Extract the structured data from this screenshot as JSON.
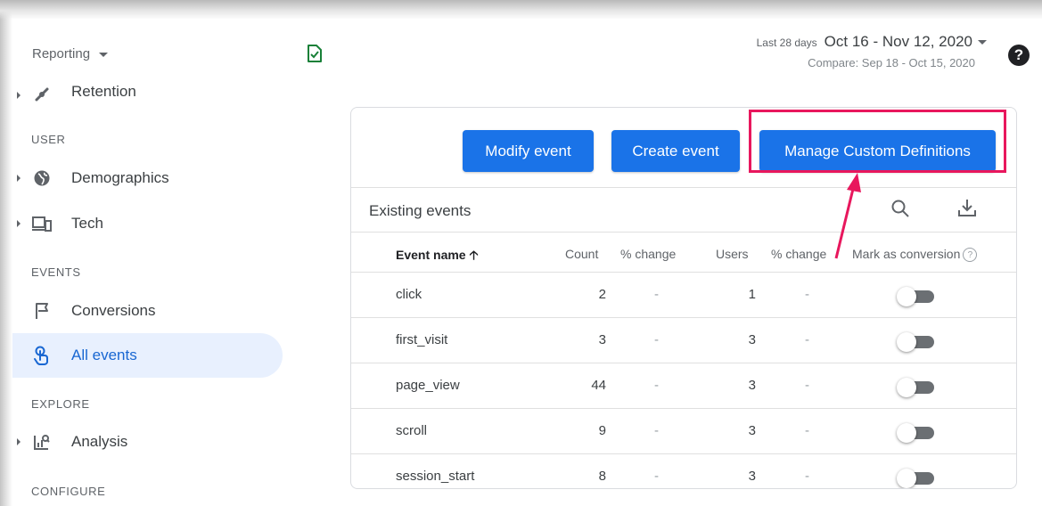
{
  "sidebar": {
    "reporting_label": "Reporting",
    "retention_label": "Retention",
    "sections": {
      "user": "USER",
      "events": "EVENTS",
      "explore": "EXPLORE",
      "configure": "CONFIGURE"
    },
    "items": [
      {
        "label": "Demographics",
        "icon": "globe-icon"
      },
      {
        "label": "Tech",
        "icon": "devices-icon"
      },
      {
        "label": "Conversions",
        "icon": "flag-icon"
      },
      {
        "label": "All events",
        "icon": "touch-icon",
        "active": true
      },
      {
        "label": "Analysis",
        "icon": "analysis-icon"
      }
    ]
  },
  "header": {
    "date_label": "Last 28 days",
    "date_range": "Oct 16 - Nov 12, 2020",
    "compare": "Compare: Sep 18 - Oct 15, 2020"
  },
  "card": {
    "buttons": {
      "modify": "Modify event",
      "create": "Create event",
      "manage": "Manage Custom Definitions"
    },
    "title": "Existing events",
    "columns": [
      "Event name",
      "Count",
      "% change",
      "Users",
      "% change",
      "Mark as conversion"
    ],
    "rows": [
      {
        "name": "click",
        "count": "2",
        "count_change": "-",
        "users": "1",
        "users_change": "-",
        "conversion": false
      },
      {
        "name": "first_visit",
        "count": "3",
        "count_change": "-",
        "users": "3",
        "users_change": "-",
        "conversion": false
      },
      {
        "name": "page_view",
        "count": "44",
        "count_change": "-",
        "users": "3",
        "users_change": "-",
        "conversion": false
      },
      {
        "name": "scroll",
        "count": "9",
        "count_change": "-",
        "users": "3",
        "users_change": "-",
        "conversion": false
      },
      {
        "name": "session_start",
        "count": "8",
        "count_change": "-",
        "users": "3",
        "users_change": "-",
        "conversion": false
      }
    ]
  },
  "colors": {
    "primary": "#1a73e8",
    "highlight": "#e8175d",
    "active_nav_bg": "#e8f0fe"
  }
}
